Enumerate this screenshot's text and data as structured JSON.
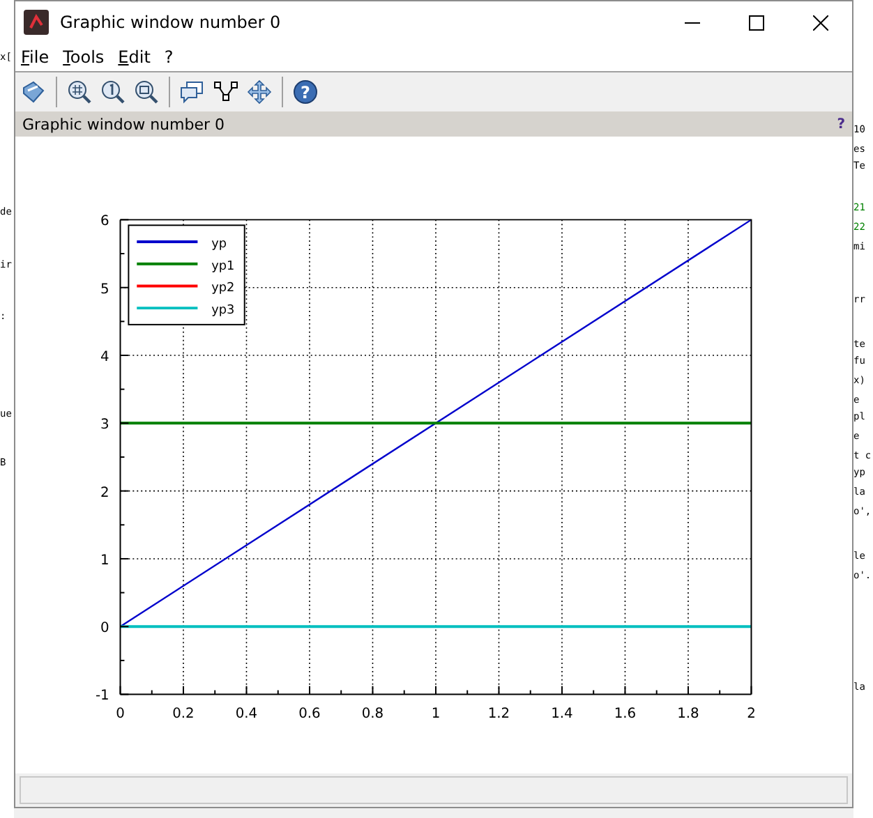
{
  "window": {
    "title": "Graphic window number 0"
  },
  "menu": [
    {
      "label": "File"
    },
    {
      "label": "Tools"
    },
    {
      "label": "Edit"
    },
    {
      "label": "?"
    }
  ],
  "toolbar": [
    {
      "kind": "rotate"
    },
    {
      "kind": "sep"
    },
    {
      "kind": "zoom-grid"
    },
    {
      "kind": "zoom-one"
    },
    {
      "kind": "zoom-area"
    },
    {
      "kind": "sep"
    },
    {
      "kind": "datatip"
    },
    {
      "kind": "edit-curve"
    },
    {
      "kind": "pan"
    },
    {
      "kind": "sep"
    },
    {
      "kind": "help",
      "label": "?"
    }
  ],
  "panel": {
    "title": "Graphic window number 0",
    "help": "?"
  },
  "plot": {
    "chart_data": {
      "type": "line",
      "grid": true,
      "legend": true,
      "x": [
        0,
        2
      ],
      "xlim": [
        0,
        2
      ],
      "ylim": [
        -1,
        6
      ],
      "xticks": [
        0,
        0.2,
        0.4,
        0.6,
        0.8,
        1,
        1.2,
        1.4,
        1.6,
        1.8,
        2
      ],
      "yticks": [
        -1,
        0,
        1,
        2,
        3,
        4,
        5,
        6
      ],
      "series": [
        {
          "name": "yp",
          "color": "#0000cc",
          "values": [
            0,
            6
          ]
        },
        {
          "name": "yp1",
          "color": "#008000",
          "values": [
            3,
            3
          ]
        },
        {
          "name": "yp2",
          "color": "#ff0000",
          "values": [
            null,
            null
          ]
        },
        {
          "name": "yp3",
          "color": "#00bfbf",
          "values": [
            0,
            0
          ]
        }
      ]
    }
  },
  "background_left": [
    {
      "text": "x["
    },
    {
      "text": "de"
    },
    {
      "text": "ir"
    },
    {
      "text": ":"
    },
    {
      "text": "ue"
    },
    {
      "text": "B"
    }
  ],
  "background_right": [
    {
      "text": "10",
      "color": "#000000"
    },
    {
      "text": "es",
      "color": "#000000"
    },
    {
      "text": "Te",
      "color": "#000000"
    },
    {
      "text": "21",
      "color": "#008000"
    },
    {
      "text": "22",
      "color": "#008000"
    },
    {
      "text": "mi",
      "color": "#000000"
    },
    {
      "text": "rr",
      "color": "#000000"
    },
    {
      "text": "te",
      "color": "#000000"
    },
    {
      "text": "fu",
      "color": "#000000"
    },
    {
      "text": "x)",
      "color": "#000000"
    },
    {
      "text": "e",
      "color": "#000000"
    },
    {
      "text": "pl",
      "color": "#000000"
    },
    {
      "text": "e",
      "color": "#000000"
    },
    {
      "text": "t c",
      "color": "#000000"
    },
    {
      "text": "yp",
      "color": "#000000"
    },
    {
      "text": "la",
      "color": "#000000"
    },
    {
      "text": "o',",
      "color": "#000000"
    },
    {
      "text": "le",
      "color": "#000000"
    },
    {
      "text": "o'.",
      "color": "#000000"
    },
    {
      "text": "la",
      "color": "#000000"
    }
  ]
}
